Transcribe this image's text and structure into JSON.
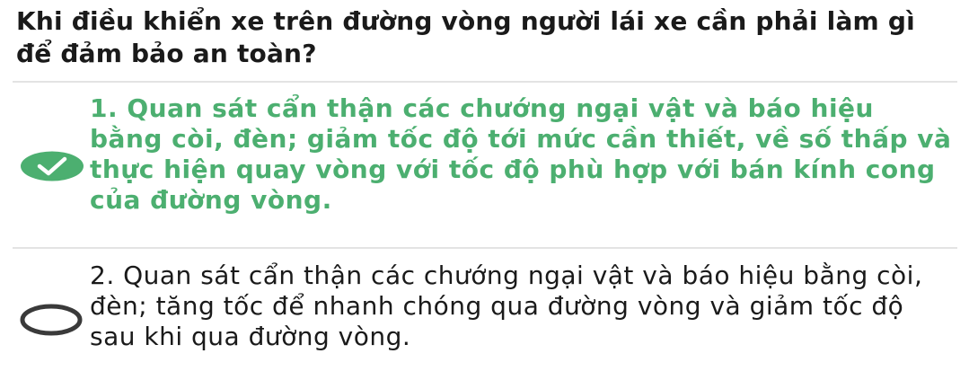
{
  "question": {
    "text": "Khi điều khiển xe trên đường vòng người lái xe cần phải làm gì để đảm bảo an toàn?"
  },
  "answers": [
    {
      "text": "1. Quan sát cẩn thận các chướng ngại vật và báo hiệu bằng còi, đèn; giảm tốc độ tới mức cần thiết, về số thấp và thực hiện quay vòng với tốc độ phù hợp với bán kính cong của đường vòng.",
      "state": "correct-selected",
      "icon": "check-icon"
    },
    {
      "text": "2. Quan sát cẩn thận các chướng ngại vật và báo hiệu bằng còi, đèn; tăng tốc để nhanh chóng qua đường vòng và giảm tốc độ sau khi qua đường vòng.",
      "state": "unselected",
      "icon": "radio-icon"
    }
  ],
  "colors": {
    "correct": "#4caf70",
    "text": "#1a1a1a",
    "divider": "#e3e3e3"
  }
}
